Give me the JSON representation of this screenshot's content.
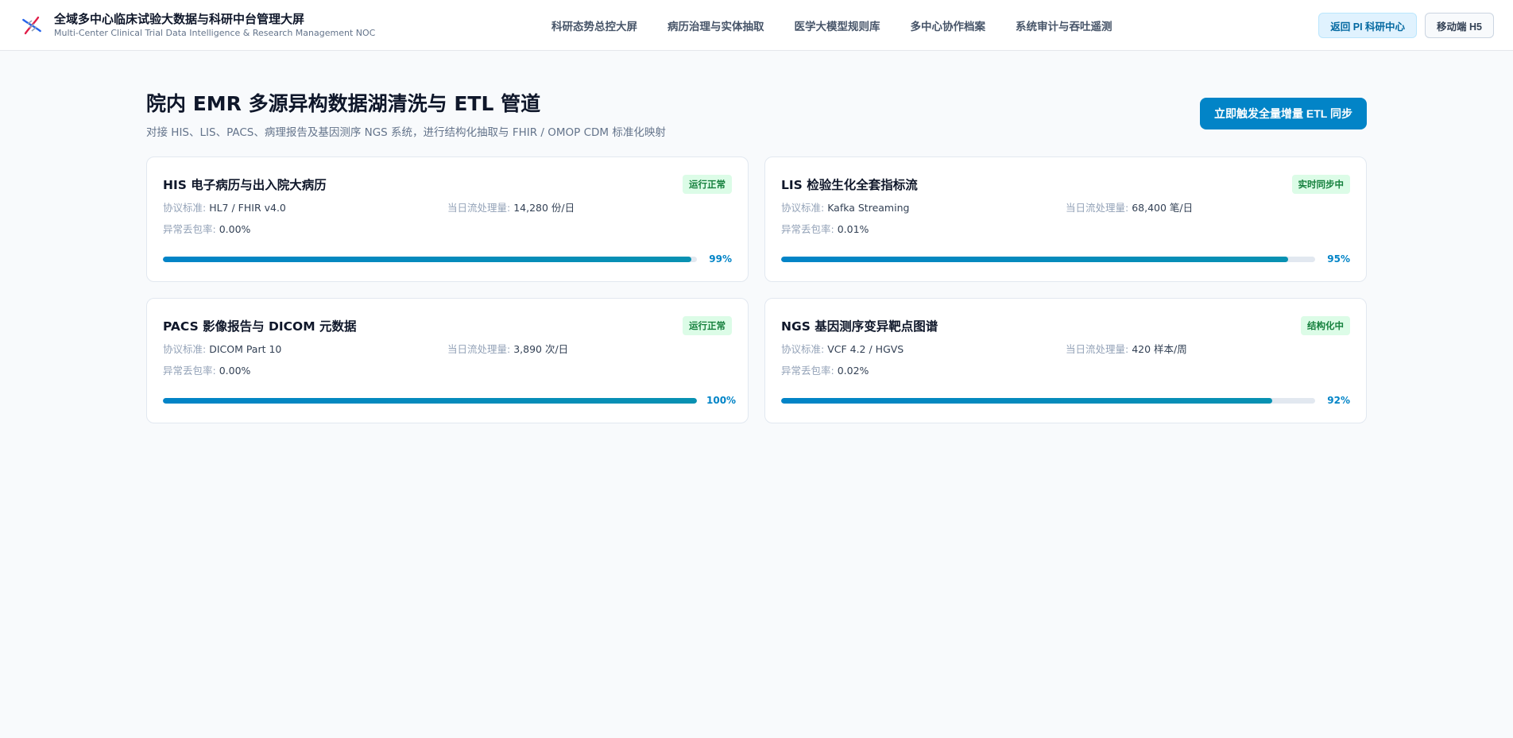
{
  "header": {
    "title": "全域多中心临床试验大数据与科研中台管理大屏",
    "subtitle": "Multi-Center Clinical Trial Data Intelligence & Research Management NOC",
    "logo_icon": "dna-icon",
    "nav": [
      {
        "label": "科研态势总控大屏"
      },
      {
        "label": "病历治理与实体抽取"
      },
      {
        "label": "医学大模型规则库"
      },
      {
        "label": "多中心协作档案"
      },
      {
        "label": "系统审计与吞吐遥测"
      }
    ],
    "back_button": "返回 PI 科研中心",
    "mobile_button": "移动端 H5"
  },
  "page": {
    "title": "院内 EMR 多源异构数据湖清洗与 ETL 管道",
    "subtitle": "对接 HIS、LIS、PACS、病理报告及基因测序 NGS 系统，进行结构化抽取与 FHIR / OMOP CDM 标准化映射",
    "action_button": "立即触发全量增量 ETL 同步"
  },
  "labels": {
    "protocol": "协议标准: ",
    "throughput": "当日流处理量: ",
    "loss": "异常丢包率: "
  },
  "sources": [
    {
      "title": "HIS 电子病历与出入院大病历",
      "badge": "运行正常",
      "protocol": "HL7 / FHIR v4.0",
      "throughput": "14,280 份/日",
      "loss": "0.00%",
      "progress": 99,
      "progress_text": "99%"
    },
    {
      "title": "LIS 检验生化全套指标流",
      "badge": "实时同步中",
      "protocol": "Kafka Streaming",
      "throughput": "68,400 笔/日",
      "loss": "0.01%",
      "progress": 95,
      "progress_text": "95%"
    },
    {
      "title": "PACS 影像报告与 DICOM 元数据",
      "badge": "运行正常",
      "protocol": "DICOM Part 10",
      "throughput": "3,890 次/日",
      "loss": "0.00%",
      "progress": 100,
      "progress_text": "100%"
    },
    {
      "title": "NGS 基因测序变异靶点图谱",
      "badge": "结构化中",
      "protocol": "VCF 4.2 / HGVS",
      "throughput": "420 样本/周",
      "loss": "0.02%",
      "progress": 92,
      "progress_text": "92%"
    }
  ],
  "colors": {
    "accent": "#0284c7",
    "badge_bg": "#dcfce7",
    "badge_text": "#15803d"
  }
}
